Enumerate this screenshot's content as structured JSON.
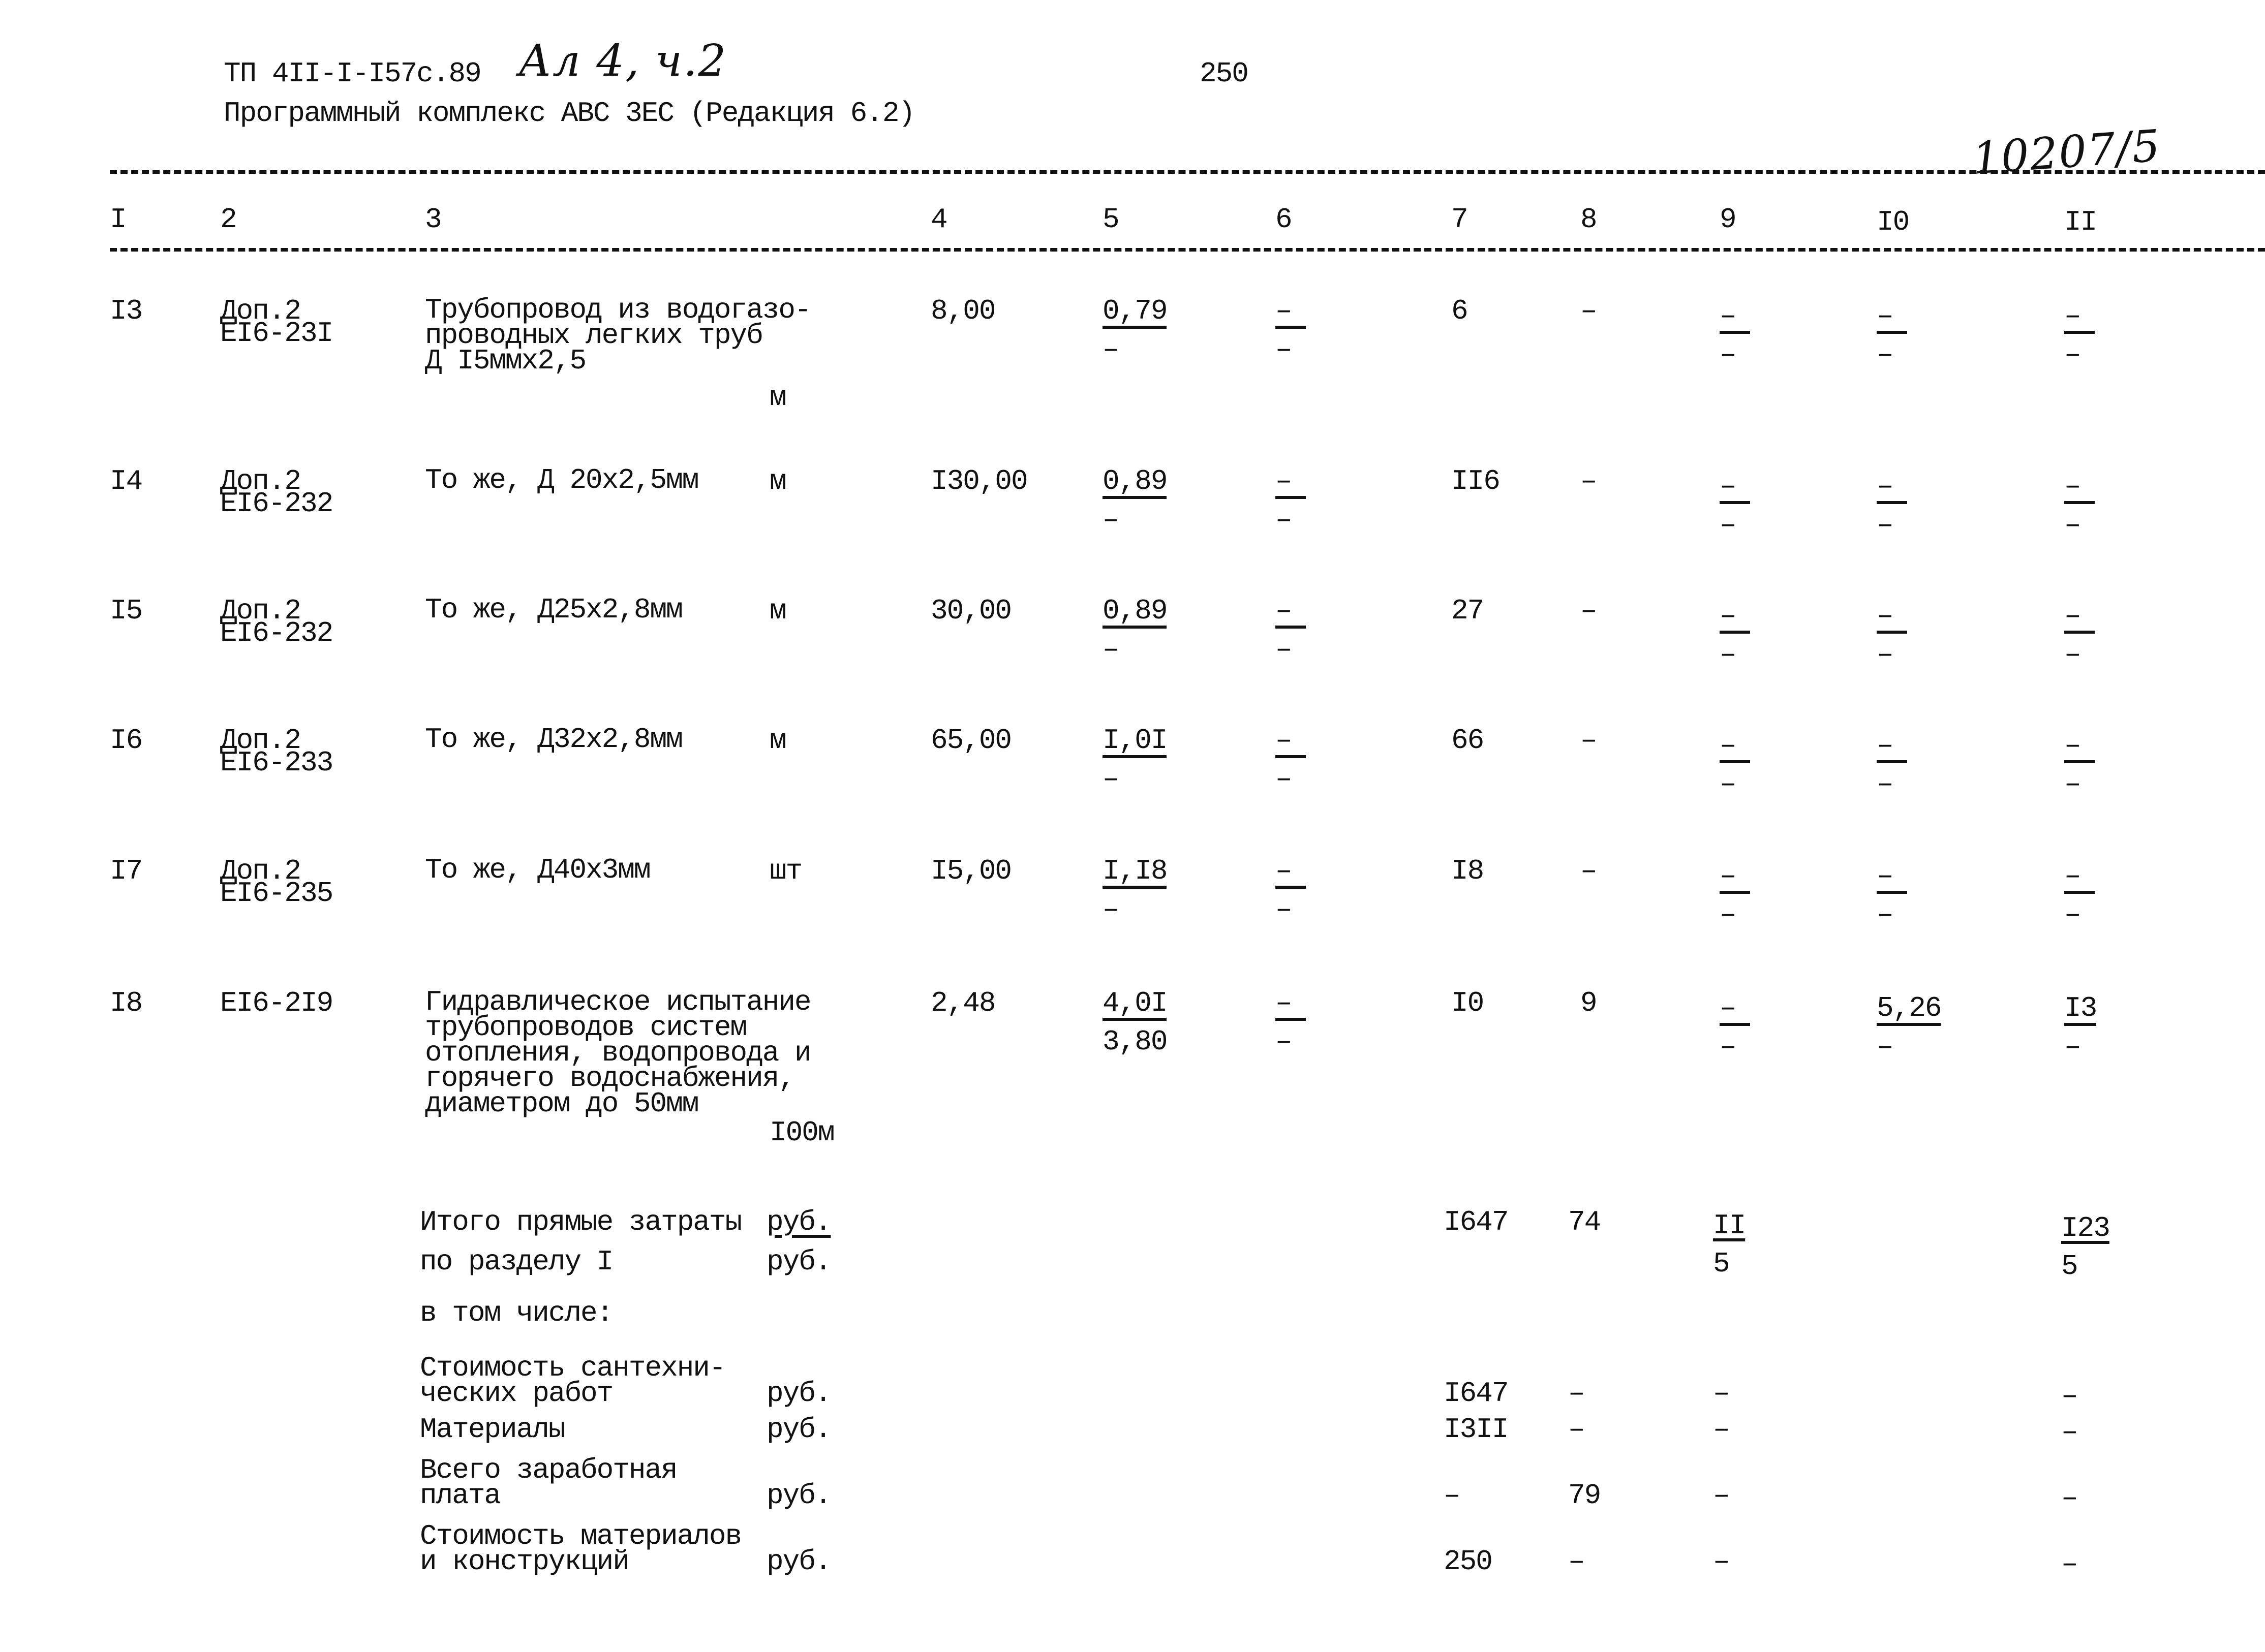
{
  "header": {
    "doc_code": "ТП 4II-I-I57с.89",
    "handwritten_volume": "Ал 4, ч.2",
    "page_number": "250",
    "program": "Программный комплекс АВС 3ЕС (Редакция 6.2)",
    "handwritten_ref": "10207/5"
  },
  "columns": [
    "I",
    "2",
    "3",
    "4",
    "5",
    "6",
    "7",
    "8",
    "9",
    "I0",
    "II"
  ],
  "rows": [
    {
      "no": "I3",
      "code_top": "Доп.2",
      "code_bottom": "ЕI6-23I",
      "desc": "Трубопровод из водогазо-\nпроводных легких труб\nД I5ммх2,5",
      "unit": "м",
      "qty": "8,00",
      "c5": {
        "num": "0,79",
        "den": "–"
      },
      "c6": {
        "num": "–",
        "den": "–"
      },
      "c7": "6",
      "c8": "–",
      "c9": {
        "num": "–",
        "den": "–"
      },
      "c10": {
        "num": "–",
        "den": "–"
      },
      "c11": {
        "num": "–",
        "den": "–"
      }
    },
    {
      "no": "I4",
      "code_top": "Доп.2",
      "code_bottom": "ЕI6-232",
      "desc": "То же, Д 20х2,5мм",
      "unit": "м",
      "qty": "I30,00",
      "c5": {
        "num": "0,89",
        "den": "–"
      },
      "c6": {
        "num": "–",
        "den": "–"
      },
      "c7": "II6",
      "c8": "–",
      "c9": {
        "num": "–",
        "den": "–"
      },
      "c10": {
        "num": "–",
        "den": "–"
      },
      "c11": {
        "num": "–",
        "den": "–"
      }
    },
    {
      "no": "I5",
      "code_top": "Доп.2",
      "code_bottom": "ЕI6-232",
      "desc": "То же, Д25х2,8мм",
      "unit": "м",
      "qty": "30,00",
      "c5": {
        "num": "0,89",
        "den": "–"
      },
      "c6": {
        "num": "–",
        "den": "–"
      },
      "c7": "27",
      "c8": "–",
      "c9": {
        "num": "–",
        "den": "–"
      },
      "c10": {
        "num": "–",
        "den": "–"
      },
      "c11": {
        "num": "–",
        "den": "–"
      }
    },
    {
      "no": "I6",
      "code_top": "Доп.2",
      "code_bottom": "ЕI6-233",
      "desc": "То же, Д32х2,8мм",
      "unit": "м",
      "qty": "65,00",
      "c5": {
        "num": "I,0I",
        "den": "–"
      },
      "c6": {
        "num": "–",
        "den": "–"
      },
      "c7": "66",
      "c8": "–",
      "c9": {
        "num": "–",
        "den": "–"
      },
      "c10": {
        "num": "–",
        "den": "–"
      },
      "c11": {
        "num": "–",
        "den": "–"
      }
    },
    {
      "no": "I7",
      "code_top": "Доп.2",
      "code_bottom": "ЕI6-235",
      "desc": "То же, Д40х3мм",
      "unit": "шт",
      "qty": "I5,00",
      "c5": {
        "num": "I,I8",
        "den": "–"
      },
      "c6": {
        "num": "–",
        "den": "–"
      },
      "c7": "I8",
      "c8": "–",
      "c9": {
        "num": "–",
        "den": "–"
      },
      "c10": {
        "num": "–",
        "den": "–"
      },
      "c11": {
        "num": "–",
        "den": "–"
      }
    },
    {
      "no": "I8",
      "code_top": "ЕI6-2I9",
      "code_bottom": "",
      "desc": "Гидравлическое испытание\nтрубопроводов систем\nотопления, водопровода и\nгорячего водоснабжения,\nдиаметром до 50мм",
      "unit": "I00м",
      "qty": "2,48",
      "c5": {
        "num": "4,0I",
        "den": "3,80"
      },
      "c6": {
        "num": "–",
        "den": "–"
      },
      "c7": "I0",
      "c8": "9",
      "c9": {
        "num": "–",
        "den": "–"
      },
      "c10": {
        "num": "5,26",
        "den": "–"
      },
      "c11": {
        "num": "I3",
        "den": "–"
      }
    }
  ],
  "totals": {
    "line1_label": "Итого прямые затраты",
    "line1_unit": "руб.",
    "line2_label": "по разделу I",
    "line2_unit": "руб.",
    "c7": "I647",
    "c8": "74",
    "c9": {
      "num": "II",
      "den": "5"
    },
    "c11": {
      "num": "I23",
      "den": "5"
    },
    "including_label": "в том числе:",
    "breakdown": [
      {
        "label": "Стоимость сантехни-\nческих работ",
        "unit": "руб.",
        "c7": "I647",
        "c8": "–",
        "c9": "–",
        "c11": "–"
      },
      {
        "label": "Материалы",
        "unit": "руб.",
        "c7": "I3II",
        "c8": "–",
        "c9": "–",
        "c11": "–"
      },
      {
        "label": "Всего заработная\nплата",
        "unit": "руб.",
        "c7": "–",
        "c8": "79",
        "c9": "–",
        "c11": "–"
      },
      {
        "label": "Стоимость материалов\nи конструкций",
        "unit": "руб.",
        "c7": "250",
        "c8": "–",
        "c9": "–",
        "c11": "–"
      }
    ]
  }
}
